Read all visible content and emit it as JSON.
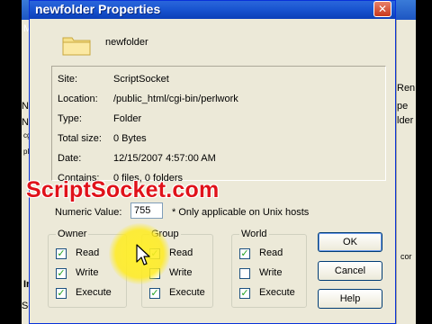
{
  "background": {
    "left_texts": [
      "M",
      "Ne",
      "Nar",
      "cgi",
      "pl",
      "Inf",
      "Sour"
    ],
    "right_texts": [
      "Ren",
      "pe",
      "lder",
      "cor"
    ]
  },
  "dialog": {
    "title": "newfolder Properties",
    "close_glyph": "✕",
    "folder_name": "newfolder",
    "info": [
      {
        "label": "Site:",
        "value": "ScriptSocket"
      },
      {
        "label": "Location:",
        "value": "/public_html/cgi-bin/perlwork"
      },
      {
        "label": "Type:",
        "value": "Folder"
      },
      {
        "label": "Total size:",
        "value": "0 Bytes"
      },
      {
        "label": "Date:",
        "value": "12/15/2007 4:57:00 AM"
      },
      {
        "label": "Contains:",
        "value": "0 files, 0 folders"
      }
    ],
    "numeric_label": "Numeric Value:",
    "numeric_value": "755",
    "numeric_note": "* Only applicable on Unix hosts",
    "groups": [
      {
        "name": "Owner",
        "items": [
          {
            "label": "Read",
            "checked": true
          },
          {
            "label": "Write",
            "checked": true
          },
          {
            "label": "Execute",
            "checked": true
          }
        ]
      },
      {
        "name": "Group",
        "items": [
          {
            "label": "Read",
            "checked": true
          },
          {
            "label": "Write",
            "checked": false
          },
          {
            "label": "Execute",
            "checked": true
          }
        ]
      },
      {
        "name": "World",
        "items": [
          {
            "label": "Read",
            "checked": true
          },
          {
            "label": "Write",
            "checked": false
          },
          {
            "label": "Execute",
            "checked": true
          }
        ]
      }
    ],
    "buttons": {
      "ok": "OK",
      "cancel": "Cancel",
      "help": "Help"
    },
    "check_glyph": "✓"
  },
  "watermark": "ScriptSocket.com",
  "colors": {
    "title_blue": "#1853cf",
    "watermark_red": "#e0121a",
    "highlight_yellow": "#ffeb1e",
    "check_green": "#21a121"
  }
}
